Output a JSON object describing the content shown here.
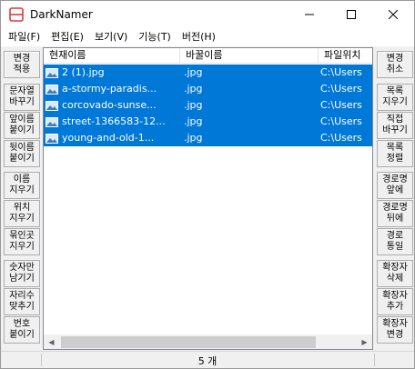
{
  "window": {
    "title": "DarkNamer",
    "accent": "#0078d7"
  },
  "menu": [
    "파일(F)",
    "편집(E)",
    "보기(V)",
    "기능(T)",
    "버전(H)"
  ],
  "left_buttons": [
    "변경\n적용",
    "문자열\n바꾸기",
    "앞이름\n붙이기",
    "뒷이름\n붙이기",
    "이름\n지우기",
    "위치\n지우기",
    "묶인곳\n지우기",
    "숫자만\n남기기",
    "자리수\n맞추기",
    "번호\n붙이기"
  ],
  "right_buttons": [
    "변경\n취소",
    "목록\n지우기",
    "직접\n바꾸기",
    "목록\n정렬",
    "경로명\n앞에",
    "경로명\n뒤에",
    "경로\n통일",
    "확장자\n삭제",
    "확장자\n추가",
    "확장자\n변경"
  ],
  "columns": [
    "현재이름",
    "바꿀이름",
    "파일위치"
  ],
  "rows": [
    {
      "name": "2 (1).jpg",
      "newname": ".jpg",
      "path": "C:\\Users"
    },
    {
      "name": "a-stormy-paradis...",
      "newname": ".jpg",
      "path": "C:\\Users"
    },
    {
      "name": "corcovado-sunse...",
      "newname": ".jpg",
      "path": "C:\\Users"
    },
    {
      "name": "street-1366583-12...",
      "newname": ".jpg",
      "path": "C:\\Users"
    },
    {
      "name": "young-and-old-1...",
      "newname": ".jpg",
      "path": "C:\\Users"
    }
  ],
  "status": {
    "count": "5 개"
  }
}
